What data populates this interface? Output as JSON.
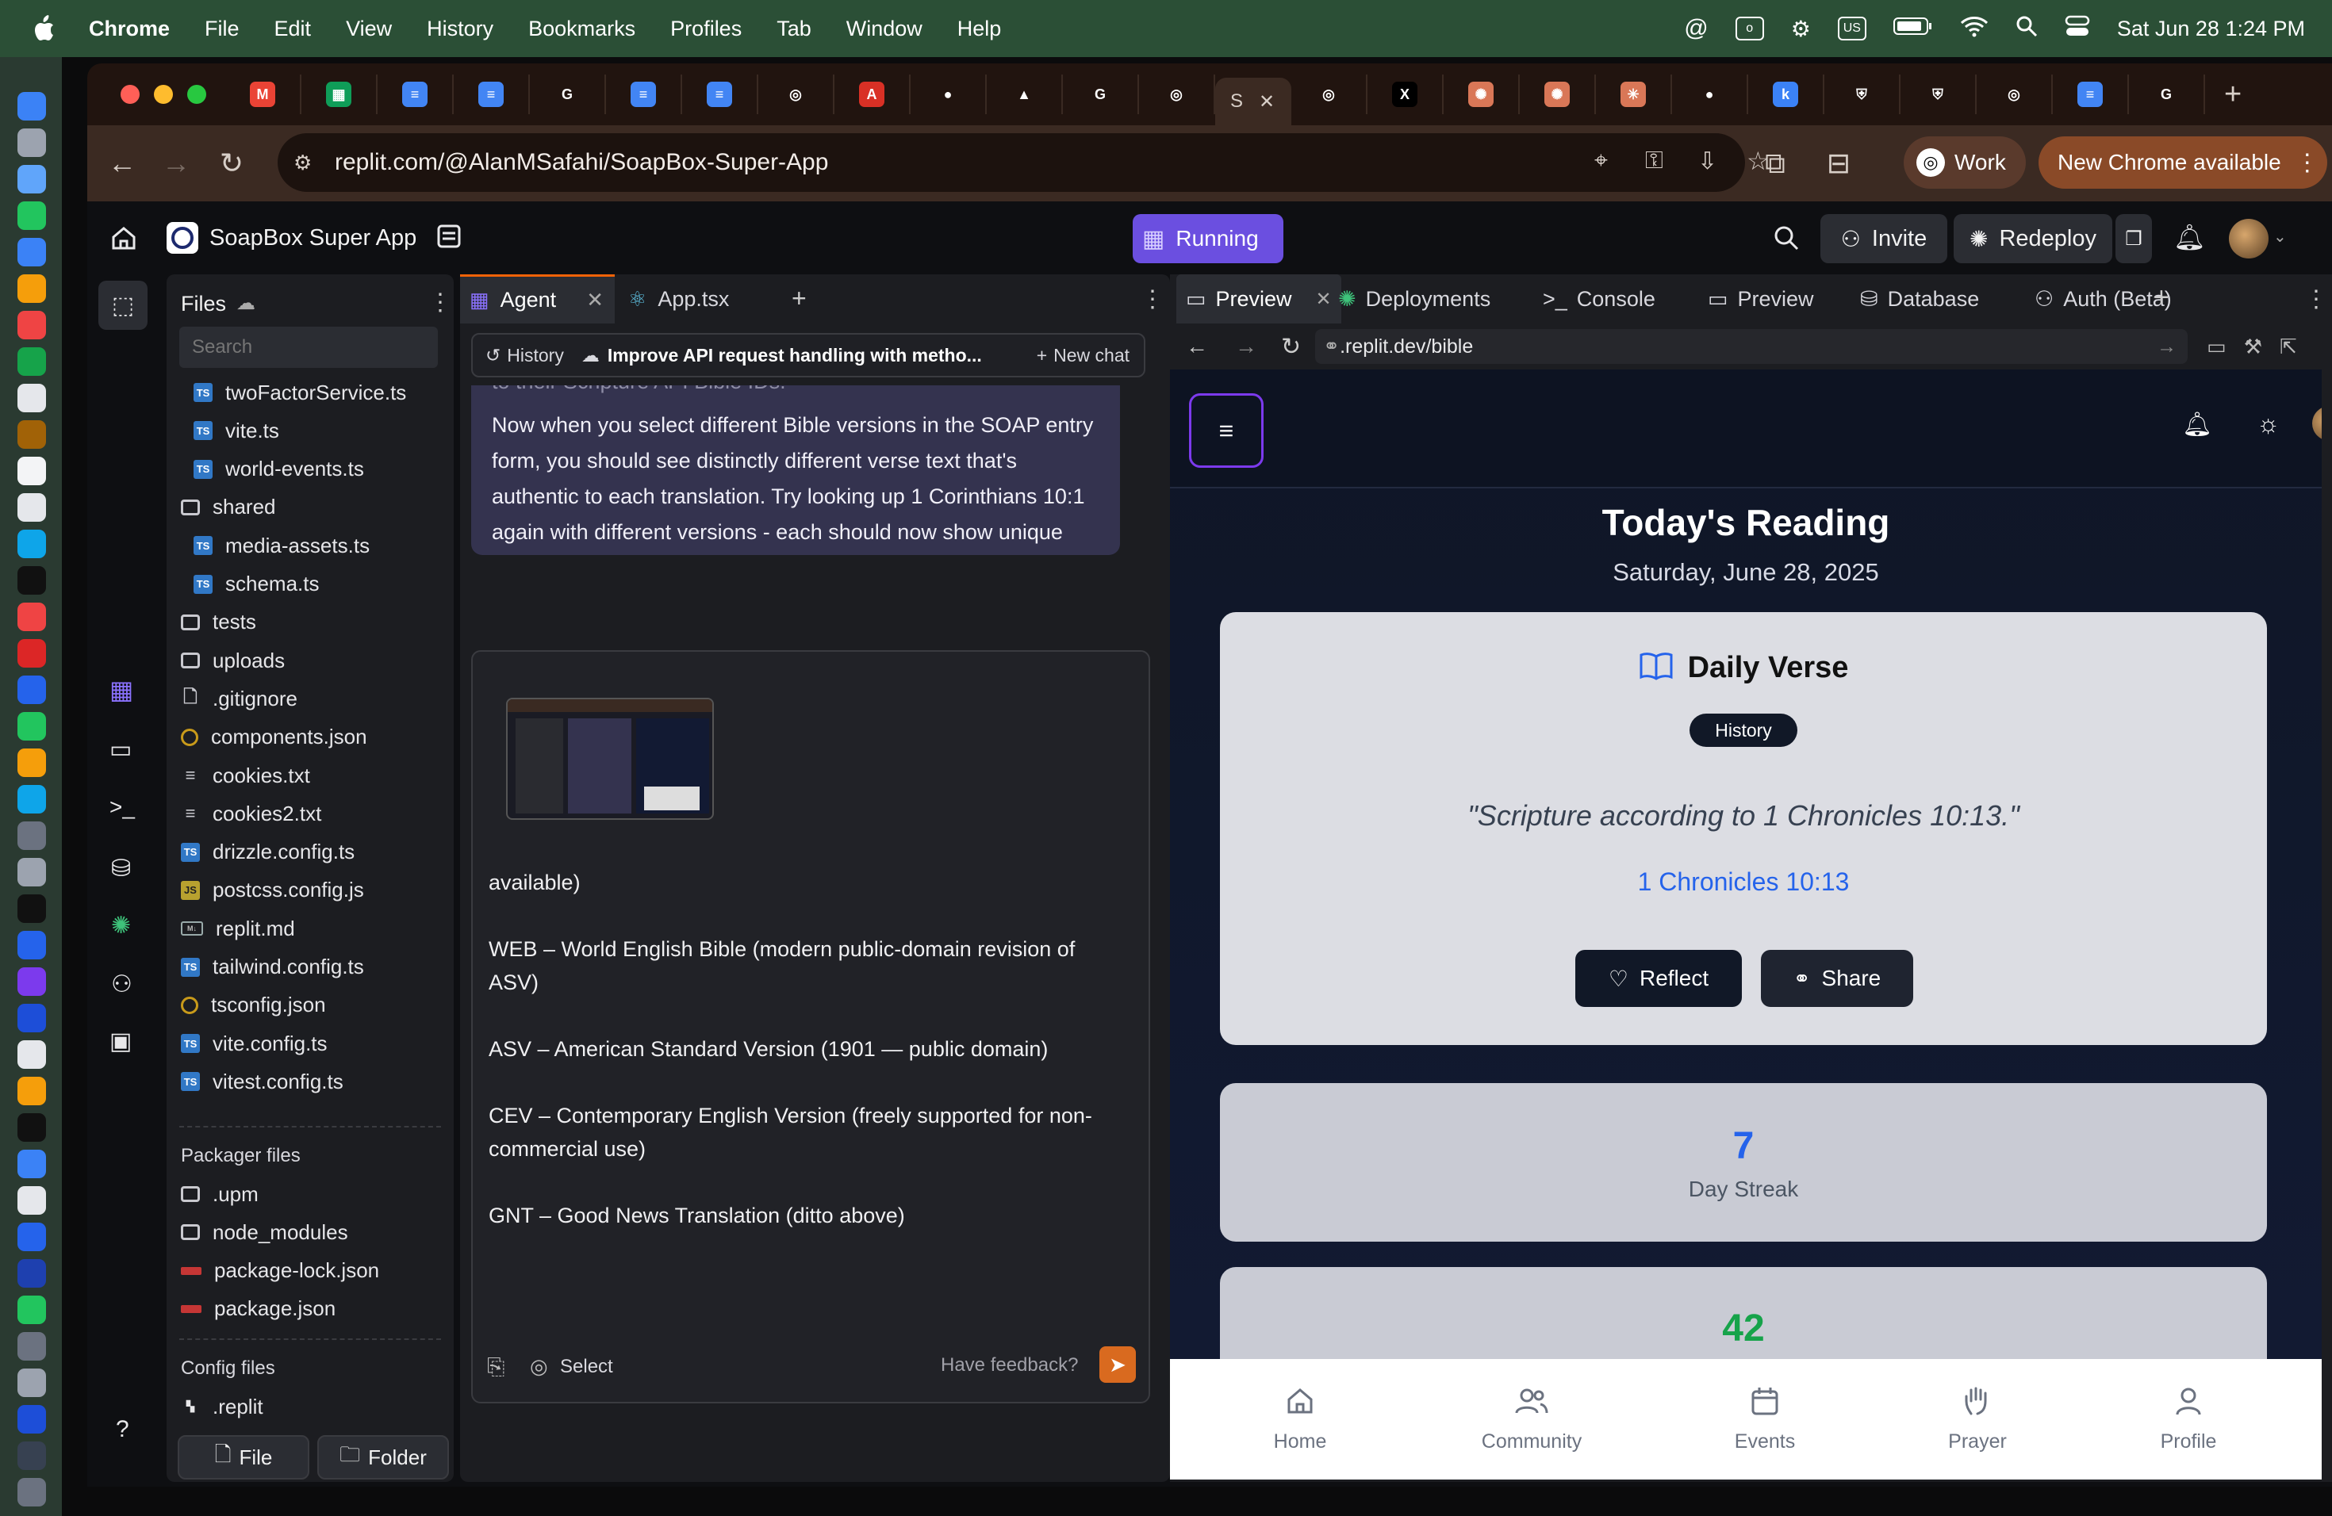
{
  "menubar": {
    "app": "Chrome",
    "items": [
      "File",
      "Edit",
      "View",
      "History",
      "Bookmarks",
      "Profiles",
      "Tab",
      "Window",
      "Help"
    ],
    "input_source": "US",
    "clock": "Sat Jun 28  1:24 PM"
  },
  "browser": {
    "url": "replit.com/@AlanMSafahi/SoapBox-Super-App",
    "active_tab_letter": "S",
    "tab_icons": [
      "gmail-icon",
      "sheets-icon",
      "docs-icon",
      "docs-icon",
      "google-icon",
      "docs-icon",
      "docs-icon",
      "openai-icon",
      "acrobat-icon",
      "github-icon",
      "drive-icon",
      "google-icon",
      "replit-icon",
      "openai-icon",
      "x-icon",
      "claude-icon",
      "claude-icon",
      "anthropic-icon",
      "github-icon",
      "k-icon",
      "shield-icon",
      "shield-icon",
      "openai-icon",
      "docs-icon",
      "google-icon"
    ],
    "profile_label": "Work",
    "update_label": "New Chrome available"
  },
  "replit": {
    "project_name": "SoapBox Super App",
    "run_status": "Running",
    "invite_label": "Invite",
    "redeploy_label": "Redeploy"
  },
  "files": {
    "title": "Files",
    "search_placeholder": "Search",
    "items": [
      {
        "name": "twoFactorService.ts",
        "type": "ts",
        "indent": 1
      },
      {
        "name": "vite.ts",
        "type": "ts",
        "indent": 1
      },
      {
        "name": "world-events.ts",
        "type": "ts",
        "indent": 1
      },
      {
        "name": "shared",
        "type": "folder",
        "indent": 0
      },
      {
        "name": "media-assets.ts",
        "type": "ts",
        "indent": 1
      },
      {
        "name": "schema.ts",
        "type": "ts",
        "indent": 1
      },
      {
        "name": "tests",
        "type": "folder",
        "indent": 0
      },
      {
        "name": "uploads",
        "type": "folder",
        "indent": 0
      },
      {
        "name": ".gitignore",
        "type": "file",
        "indent": 0
      },
      {
        "name": "components.json",
        "type": "json",
        "indent": 0
      },
      {
        "name": "cookies.txt",
        "type": "text",
        "indent": 0
      },
      {
        "name": "cookies2.txt",
        "type": "text",
        "indent": 0
      },
      {
        "name": "drizzle.config.ts",
        "type": "ts",
        "indent": 0
      },
      {
        "name": "postcss.config.js",
        "type": "js",
        "indent": 0
      },
      {
        "name": "replit.md",
        "type": "md",
        "indent": 0
      },
      {
        "name": "tailwind.config.ts",
        "type": "ts",
        "indent": 0
      },
      {
        "name": "tsconfig.json",
        "type": "json",
        "indent": 0
      },
      {
        "name": "vite.config.ts",
        "type": "ts",
        "indent": 0
      },
      {
        "name": "vitest.config.ts",
        "type": "ts",
        "indent": 0
      }
    ],
    "packager_title": "Packager files",
    "packager_items": [
      {
        "name": ".upm",
        "type": "folder"
      },
      {
        "name": "node_modules",
        "type": "folder"
      },
      {
        "name": "package-lock.json",
        "type": "npm"
      },
      {
        "name": "package.json",
        "type": "npm"
      }
    ],
    "config_title": "Config files",
    "config_items": [
      {
        "name": ".replit",
        "type": "replit"
      }
    ],
    "new_file_label": "File",
    "new_folder_label": "Folder"
  },
  "agent": {
    "tabs": [
      "Agent",
      "App.tsx"
    ],
    "history_label": "History",
    "chat_title": "Improve API request handling with metho...",
    "new_chat_label": "New chat",
    "cut_text": "to their Scripture API Bible IDs.",
    "message": "Now when you select different Bible versions in the SOAP entry form, you should see distinctly different verse text that's authentic to each translation. Try looking up 1 Corinthians 10:1 again with different versions - each should now show unique translation text!",
    "draft_lines": [
      "available)",
      "WEB – World English Bible (modern public-domain revision of ASV)",
      "ASV – American Standard Version (1901 — public domain)",
      "CEV – Contemporary English Version (freely supported for non-commercial use)",
      "GNT – Good News Translation (ditto above)"
    ],
    "select_label": "Select",
    "feedback_placeholder": "Have feedback?"
  },
  "preview": {
    "tabs": [
      "Preview",
      "Deployments",
      "Console",
      "Preview",
      "Database",
      "Auth (Beta)"
    ],
    "url_host": ".replit.dev",
    "url_path": "/bible"
  },
  "app": {
    "heading": "Today's Reading",
    "date": "Saturday, June 28, 2025",
    "card_title": "Daily Verse",
    "badge": "History",
    "quote": "\"Scripture according to 1 Chronicles 10:13.\"",
    "reference": "1 Chronicles 10:13",
    "reflect_label": "Reflect",
    "share_label": "Share",
    "streak_value": "7",
    "streak_label": "Day Streak",
    "next_value": "42",
    "colors": {
      "accent": "#2563eb",
      "purple": "#7c3aed",
      "green": "#16a34a"
    },
    "bottom_nav": [
      "Home",
      "Community",
      "Events",
      "Prayer",
      "Profile"
    ]
  }
}
